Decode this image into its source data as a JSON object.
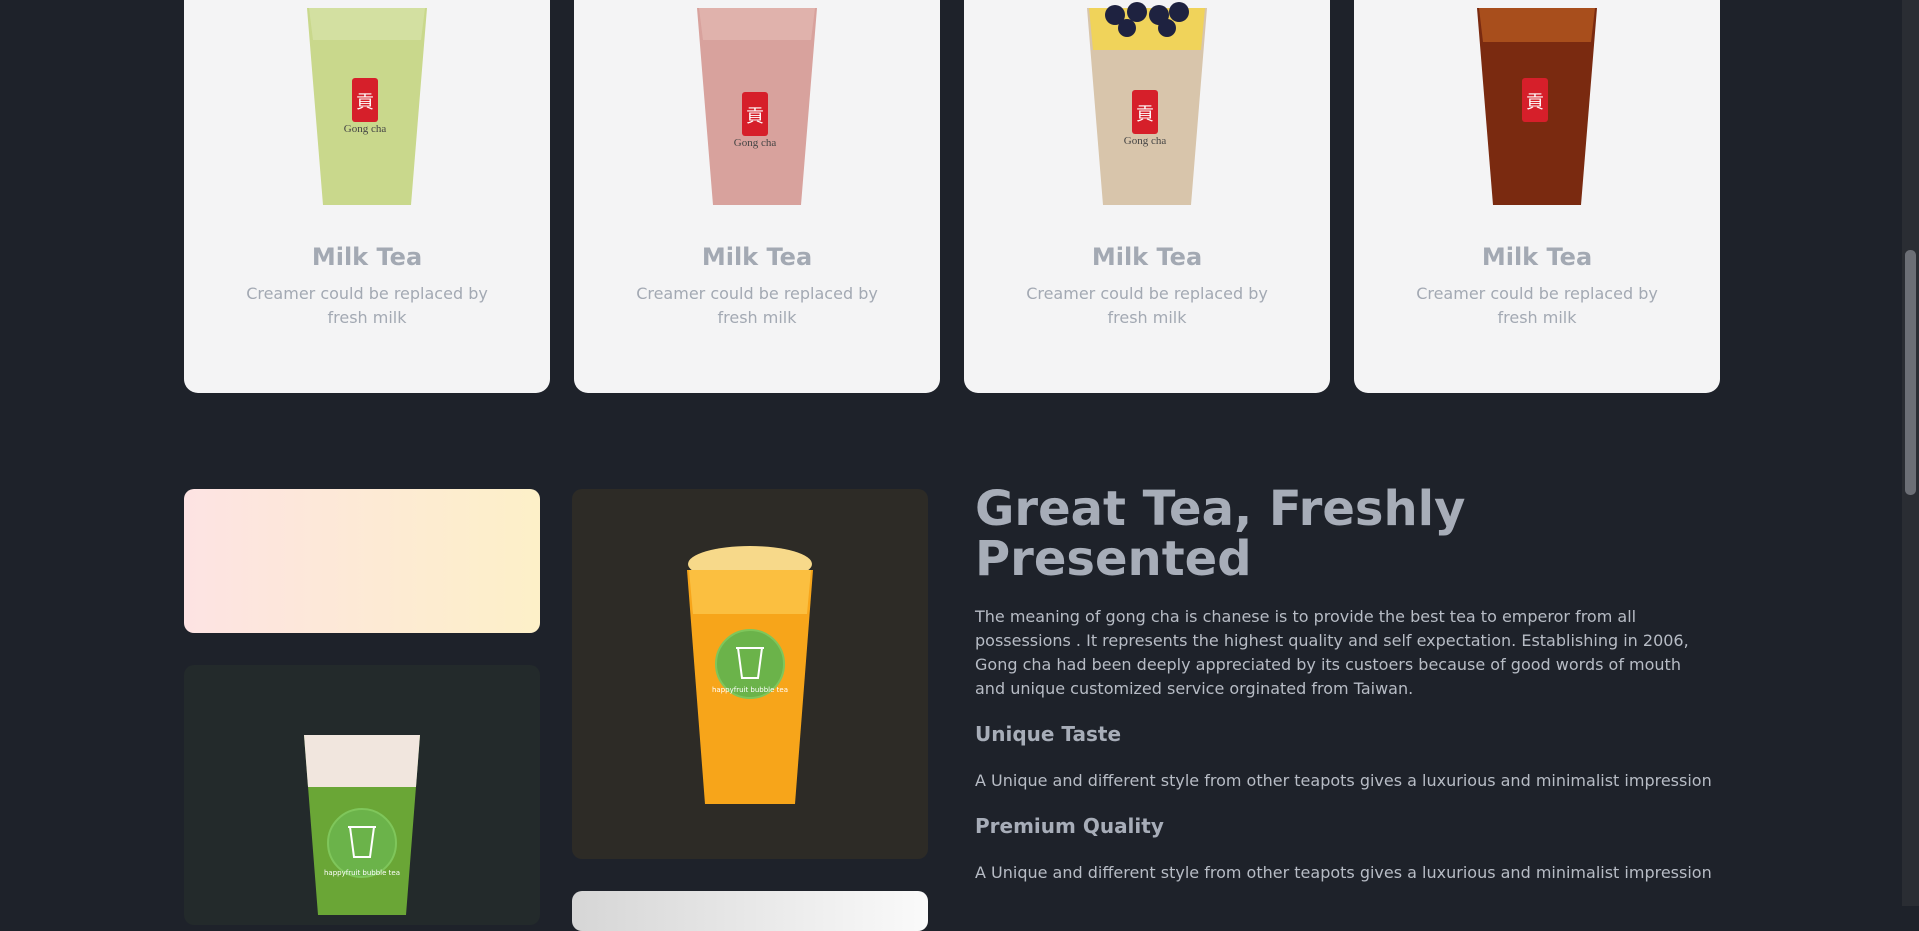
{
  "products": [
    {
      "title": "Milk Tea",
      "description": "Creamer could be replaced by fresh milk",
      "drink_color": "#c7d58a",
      "brand": "Gong cha"
    },
    {
      "title": "Milk Tea",
      "description": "Creamer could be replaced by fresh milk",
      "drink_color": "#d9a49f",
      "brand": "Gong cha"
    },
    {
      "title": "Milk Tea",
      "description": "Creamer could be replaced by fresh milk",
      "drink_color": "#d9c6ad",
      "brand": "Gong cha"
    },
    {
      "title": "Milk Tea",
      "description": "Creamer could be replaced by fresh milk",
      "drink_color": "#7a2a10",
      "brand": ""
    }
  ],
  "about": {
    "heading": "Great Tea, Freshly Presented",
    "paragraph": "The meaning of gong cha is chanese is to provide the best tea to emperor from all possessions . It represents the highest quality and self expectation. Establishing in 2006, Gong cha had been deeply appreciated by its custoers because of good words of mouth and unique customized service orginated from Taiwan.",
    "features": [
      {
        "title": "Unique Taste",
        "description": "A Unique and different style from other teapots gives a luxurious and minimalist impression"
      },
      {
        "title": "Premium Quality",
        "description": "A Unique and different style from other teapots gives a luxurious and minimalist impression"
      }
    ]
  },
  "gallery": {
    "badge_text": "happyfruit bubble tea",
    "colors": {
      "orange_drink": "#f7a51a",
      "green_drink": "#6aa636",
      "badge": "#6bb34a",
      "dark_tile": "#2d2b26",
      "green_tile": "#232a2b"
    }
  },
  "icons": [
    "tea-cup-icon"
  ]
}
